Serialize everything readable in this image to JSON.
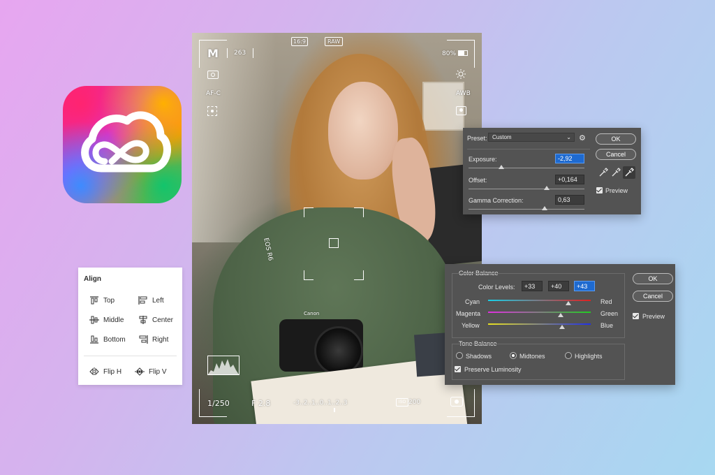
{
  "app_icon": {
    "icon": "creative-cloud-icon"
  },
  "align_panel": {
    "title": "Align",
    "items": [
      {
        "label": "Top",
        "icon": "align-top-icon"
      },
      {
        "label": "Left",
        "icon": "align-left-icon"
      },
      {
        "label": "Middle",
        "icon": "align-middle-icon"
      },
      {
        "label": "Center",
        "icon": "align-center-icon"
      },
      {
        "label": "Bottom",
        "icon": "align-bottom-icon"
      },
      {
        "label": "Right",
        "icon": "align-right-icon"
      },
      {
        "label": "Flip H",
        "icon": "flip-horizontal-icon"
      },
      {
        "label": "Flip V",
        "icon": "flip-vertical-icon"
      }
    ]
  },
  "viewfinder": {
    "mode": "M",
    "shots": "263",
    "aspect": "16:9",
    "format": "RAW",
    "battery": "80%",
    "focus": "AF-C",
    "white_balance": "AWB",
    "shutter": "1/250",
    "aperture": "F 2.8",
    "exposure_scale": "-3..2..1..0..1..2..3",
    "iso_label": "ISO",
    "iso": "200",
    "camera_brand": "EOS R6",
    "camera_logo": "Canon"
  },
  "exposure_dialog": {
    "preset_label": "Preset:",
    "preset_value": "Custom",
    "ok": "OK",
    "cancel": "Cancel",
    "preview": "Preview",
    "exposure_label": "Exposure:",
    "exposure_value": "-2,92",
    "offset_label": "Offset:",
    "offset_value": "+0,164",
    "gamma_label": "Gamma Correction:",
    "gamma_value": "0,63",
    "eyedroppers": [
      "eyedropper-black-icon",
      "eyedropper-gray-icon",
      "eyedropper-white-icon"
    ]
  },
  "color_balance_dialog": {
    "group_title": "Color Balance",
    "levels_label": "Color Levels:",
    "levels": [
      "+33",
      "+40",
      "+43"
    ],
    "sliders": [
      {
        "left": "Cyan",
        "right": "Red",
        "value": 0.78
      },
      {
        "left": "Magenta",
        "right": "Green",
        "value": 0.71
      },
      {
        "left": "Yellow",
        "right": "Blue",
        "value": 0.72
      }
    ],
    "tone_title": "Tone Balance",
    "tones": [
      "Shadows",
      "Midtones",
      "Highlights"
    ],
    "selected_tone": "Midtones",
    "preserve": "Preserve Luminosity",
    "ok": "OK",
    "cancel": "Cancel",
    "preview": "Preview"
  }
}
